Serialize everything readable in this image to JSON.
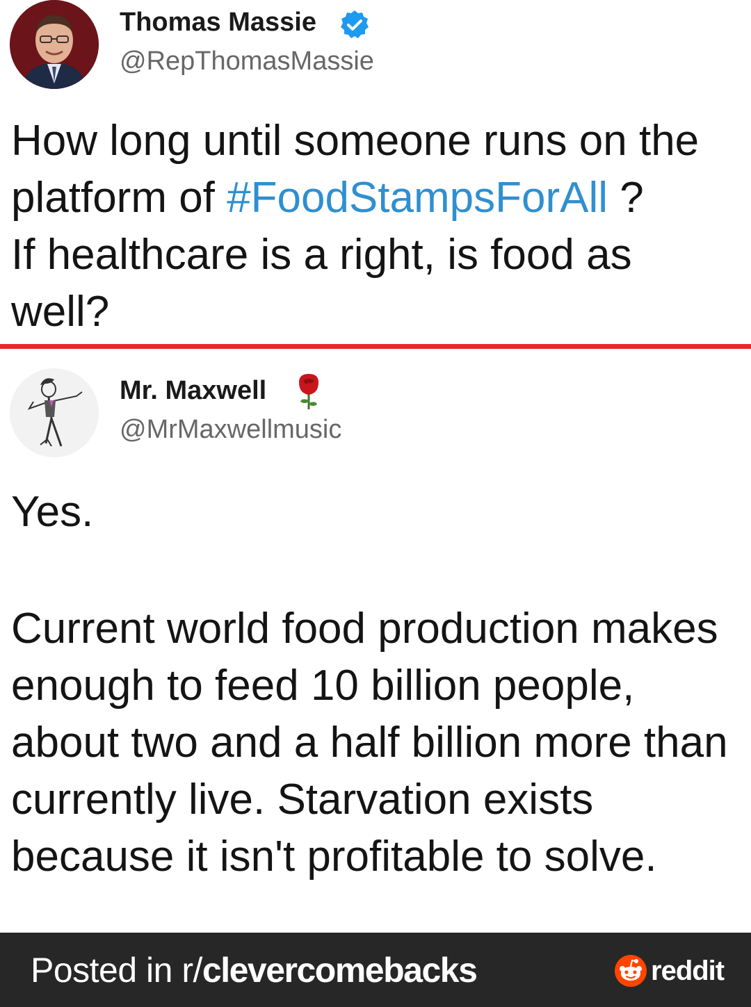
{
  "tweet1": {
    "avatar_icon": "user-avatar-icon",
    "display_name": "Thomas Massie",
    "verified_icon": "verified-badge-icon",
    "handle": "@RepThomasMassie",
    "text_part1": "How long until someone runs on the platform of ",
    "hashtag": "#FoodStampsForAll",
    "text_part2": " ?",
    "text_part3": "If healthcare is a right, is food as well?"
  },
  "tweet2": {
    "avatar_icon": "user-avatar-icon",
    "display_name": "Mr. Maxwell",
    "emoji_icon": "rose-icon",
    "handle": "@MrMaxwellmusic",
    "text_line1": "Yes.",
    "text_paragraph": "Current world food production makes enough to feed 10 billion people, about two and a half billion more than currently live. Starvation exists because it isn't profitable to solve."
  },
  "footer": {
    "prefix": "Posted in r/",
    "subreddit": "clevercomebacks",
    "brand_icon": "reddit-alien-icon",
    "brand": "reddit"
  },
  "colors": {
    "hashtag": "#2f8fd0",
    "divider": "#e4292a",
    "footer_bg": "#272727",
    "verified": "#1d9bf0",
    "reddit_orange": "#ff4500"
  }
}
